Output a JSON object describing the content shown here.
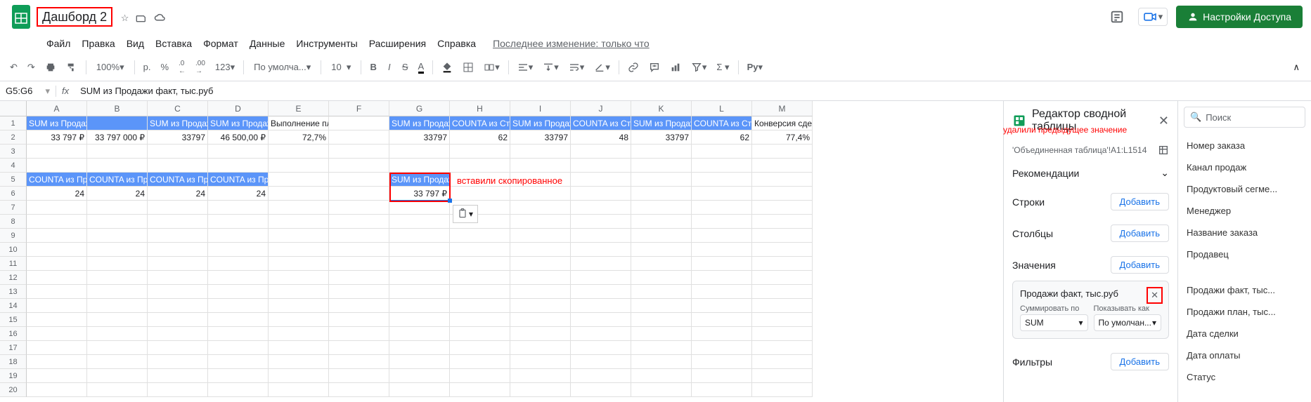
{
  "header": {
    "doc_title": "Дашборд 2",
    "share_label": "Настройки Доступа",
    "last_edit": "Последнее изменение: только что"
  },
  "menubar": [
    "Файл",
    "Правка",
    "Вид",
    "Вставка",
    "Формат",
    "Данные",
    "Инструменты",
    "Расширения",
    "Справка"
  ],
  "toolbar": {
    "zoom": "100%",
    "currency": "р.",
    "percent": "%",
    "dec_dec": ".0",
    "dec_inc": ".00",
    "num_fmt": "123",
    "font": "По умолча...",
    "font_size": "10",
    "script": "Ру"
  },
  "formula": {
    "cell_ref": "G5:G6",
    "fx": "fx",
    "value": "SUM из Продажи факт, тыс.руб"
  },
  "columns": [
    "A",
    "B",
    "C",
    "D",
    "E",
    "F",
    "G",
    "H",
    "I",
    "J",
    "K",
    "L",
    "M"
  ],
  "rows": {
    "r1": [
      "SUM из Продаж",
      "",
      "SUM из Продаж",
      "SUM из Продаж",
      "Выполнение плана",
      "",
      "SUM из Продаж",
      "COUNTA из Ста",
      "SUM из Продаж",
      "COUNTA из Ста",
      "SUM из Продаж",
      "COUNTA из Ста",
      "Конверсия сделок"
    ],
    "r2": [
      "33 797 ₽",
      "33 797 000 ₽",
      "33797",
      "46 500,00 ₽",
      "72,7%",
      "",
      "33797",
      "62",
      "33797",
      "48",
      "33797",
      "62",
      "77,4%"
    ],
    "r5": [
      "COUNTA из Прс",
      "COUNTA из Прс",
      "COUNTA из Прс",
      "COUNTA из Прс",
      "",
      "",
      "SUM из Продаж",
      "",
      "",
      "",
      "",
      "",
      ""
    ],
    "r6": [
      "24",
      "24",
      "24",
      "24",
      "",
      "",
      "33 797 ₽",
      "",
      "",
      "",
      "",
      "",
      ""
    ]
  },
  "annotations": {
    "paste_text": "вставили скопированное",
    "delete_text": "удалили предыдущее значение"
  },
  "sidebar": {
    "title": "Редактор сводной таблицы",
    "range": "'Объединенная таблица'!A1:L1514",
    "recommendations": "Рекомендации",
    "rows": "Строки",
    "columns": "Столбцы",
    "values": "Значения",
    "filters": "Фильтры",
    "add_btn": "Добавить",
    "value_card": {
      "title": "Продажи факт, тыс.руб",
      "sum_by_label": "Суммировать по",
      "sum_by_value": "SUM",
      "show_as_label": "Показывать как",
      "show_as_value": "По умолчан..."
    }
  },
  "fieldlist": {
    "search_placeholder": "Поиск",
    "items": [
      "Номер заказа",
      "Канал продаж",
      "Продуктовый сегме...",
      "Менеджер",
      "Название заказа",
      "Продавец",
      "",
      "Продажи факт, тыс...",
      "Продажи план, тыс...",
      "Дата сделки",
      "Дата оплаты",
      "Статус"
    ]
  }
}
